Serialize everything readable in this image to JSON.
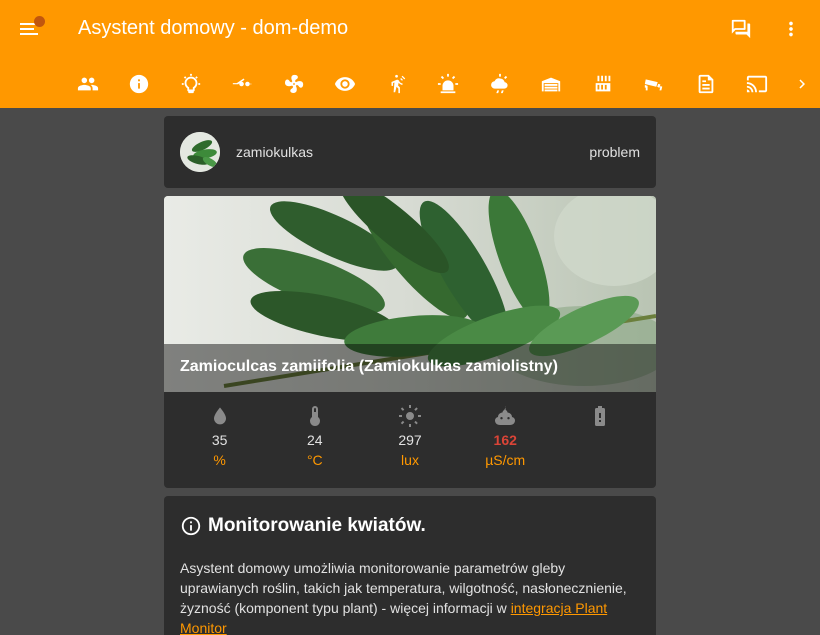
{
  "app": {
    "title": "Asystent domowy - dom-demo"
  },
  "header": {
    "icons": [
      "menu-icon",
      "notification-dot",
      "chat-icon",
      "more-vert-icon"
    ]
  },
  "tabs": [
    "people-icon",
    "info-icon",
    "lightbulb-icon",
    "switch-icon",
    "fan-icon",
    "eye-icon",
    "motion-sensor-icon",
    "alarm-light-icon",
    "weather-icon",
    "garage-icon",
    "radiator-icon",
    "camera-icon",
    "file-document-icon",
    "cast-icon",
    "chevron-right-icon"
  ],
  "entity": {
    "name": "zamiokulkas",
    "state": "problem"
  },
  "plant": {
    "name": "Zamioculcas zamiifolia (Zamiokulkas zamiolistny)",
    "sensors": [
      {
        "icon": "water-drop-icon",
        "value": "35",
        "unit": "%",
        "problem": false
      },
      {
        "icon": "thermometer-icon",
        "value": "24",
        "unit": "°C",
        "problem": false
      },
      {
        "icon": "sun-icon",
        "value": "297",
        "unit": "lux",
        "problem": false
      },
      {
        "icon": "fertilizer-icon",
        "value": "162",
        "unit": "µS/cm",
        "problem": true
      },
      {
        "icon": "battery-alert-icon",
        "value": "",
        "unit": "",
        "problem": false
      }
    ]
  },
  "info": {
    "title": "Monitorowanie kwiatów.",
    "text": "Asystent domowy umożliwia monitorowanie parametrów gleby uprawianych roślin, takich jak temperatura, wilgotność, nasłonecznienie, żyzność (komponent typu plant) - więcej informacji w ",
    "link": "integracja Plant Monitor"
  },
  "colors": {
    "accent": "#ff9800",
    "problem": "#db4437",
    "card": "#2d2d2d",
    "background": "#4a4a4a"
  }
}
